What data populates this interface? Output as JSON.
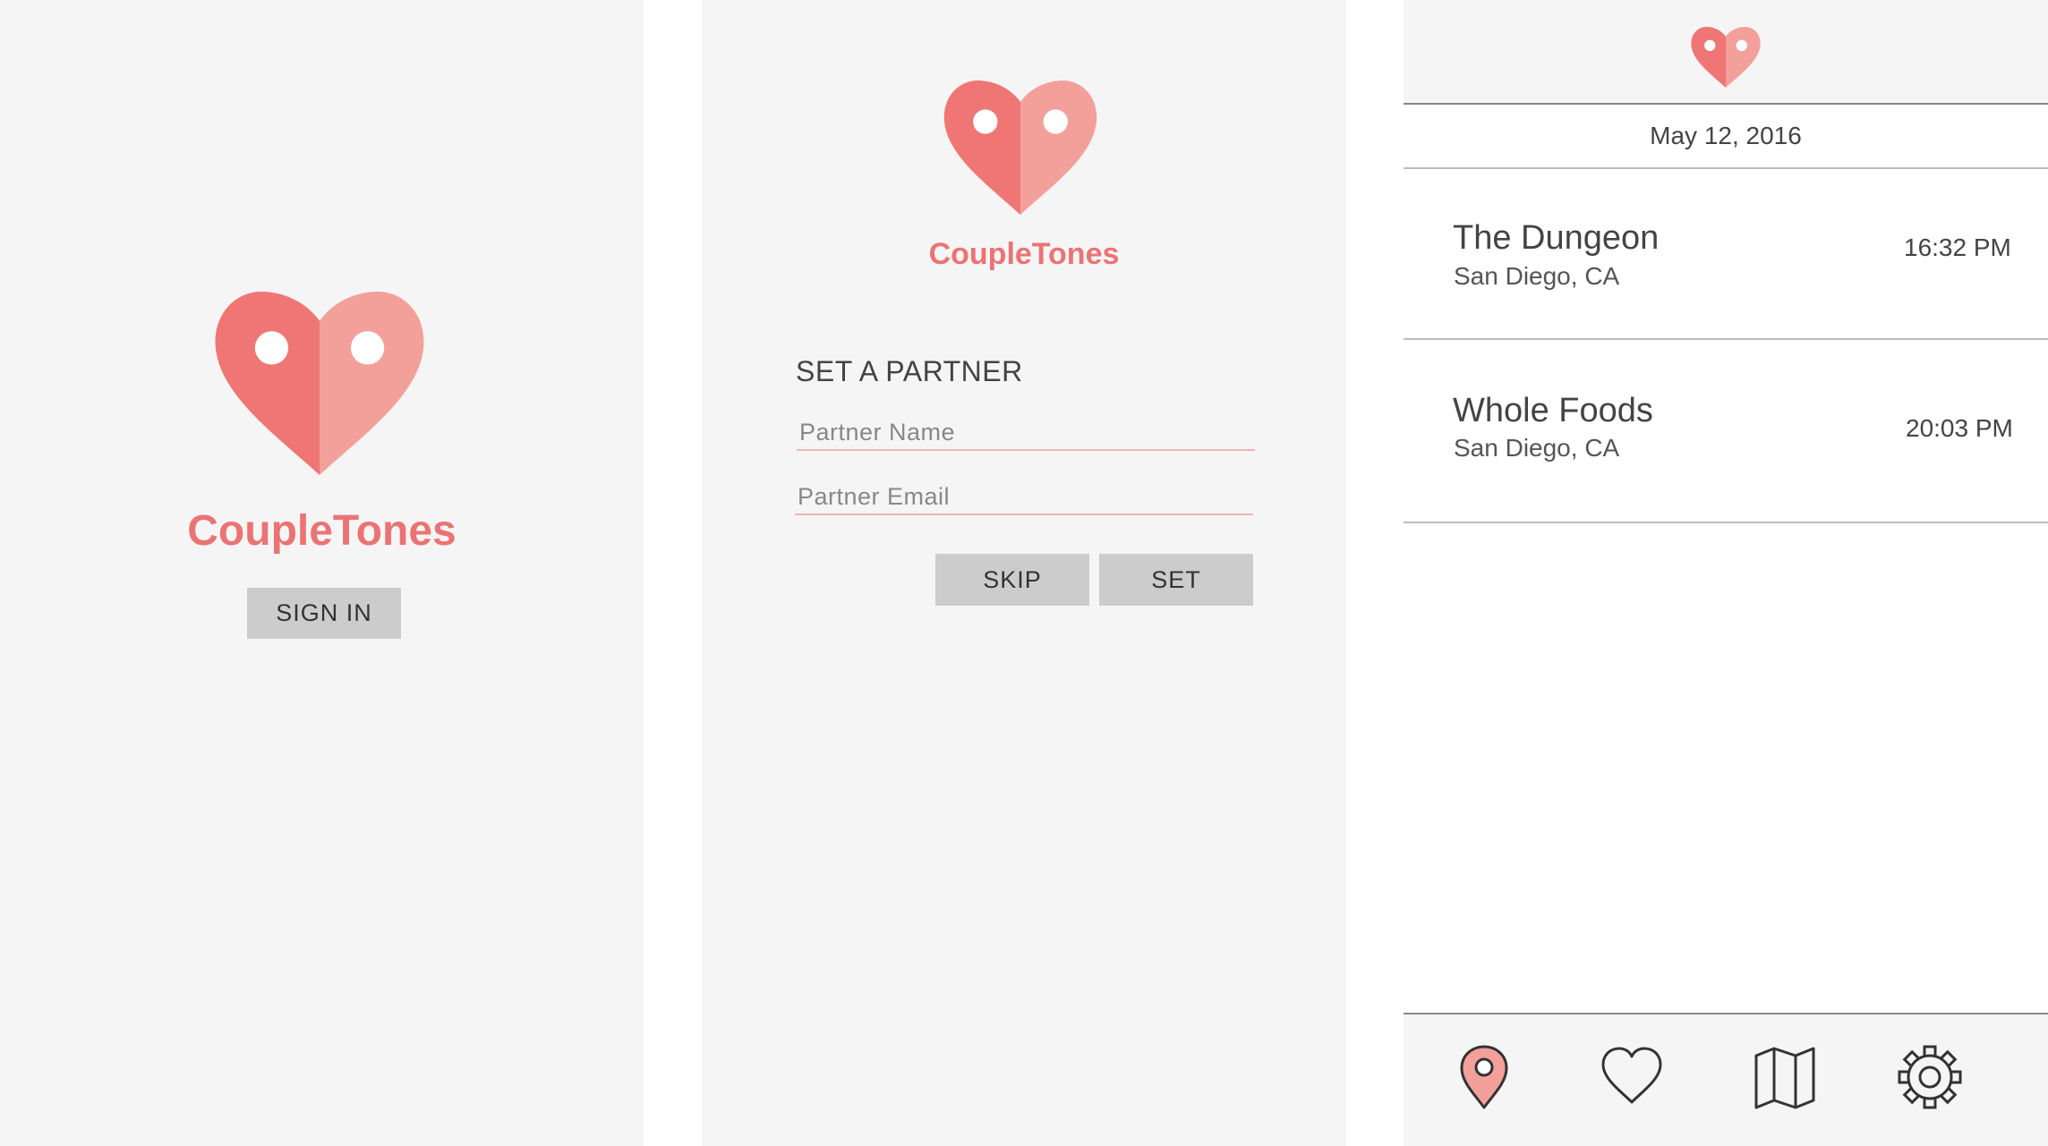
{
  "colors": {
    "brand": "#ec7373",
    "brand_light": "#f3a09b",
    "screen_bg": "#f5f5f5",
    "button_bg": "#cccccc"
  },
  "signin_screen": {
    "logo_icon": "heart-pin-logo-icon",
    "brand": "CoupleTones",
    "signin_label": "SIGN IN"
  },
  "partner_screen": {
    "logo_icon": "heart-pin-logo-icon",
    "brand": "CoupleTones",
    "heading": "SET A PARTNER",
    "name_placeholder": "Partner Name",
    "email_placeholder": "Partner Email",
    "skip_label": "SKIP",
    "set_label": "SET"
  },
  "history_screen": {
    "logo_icon": "heart-pin-logo-icon",
    "date": "May 12, 2016",
    "entries": [
      {
        "place": "The Dungeon",
        "city": "San Diego, CA",
        "time": "16:32 PM"
      },
      {
        "place": "Whole Foods",
        "city": "San Diego, CA",
        "time": "20:03 PM"
      }
    ],
    "nav": [
      {
        "icon": "location-pin-icon",
        "active": true
      },
      {
        "icon": "heart-icon",
        "active": false
      },
      {
        "icon": "map-icon",
        "active": false
      },
      {
        "icon": "gear-icon",
        "active": false
      }
    ]
  }
}
